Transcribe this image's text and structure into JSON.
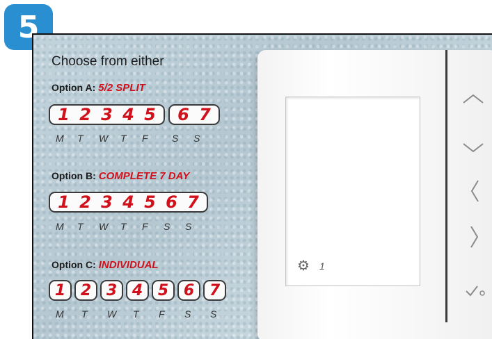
{
  "step_number": "5",
  "intro": "Choose from either",
  "options": [
    {
      "label": "Option A:",
      "name": "5/2 SPLIT",
      "groups": [
        [
          "1",
          "2",
          "3",
          "4",
          "5"
        ],
        [
          "6",
          "7"
        ]
      ]
    },
    {
      "label": "Option B:",
      "name": "COMPLETE 7 DAY",
      "groups": [
        [
          "1",
          "2",
          "3",
          "4",
          "5",
          "6",
          "7"
        ]
      ]
    },
    {
      "label": "Option C:",
      "name": "INDIVIDUAL",
      "groups": [
        [
          "1"
        ],
        [
          "2"
        ],
        [
          "3"
        ],
        [
          "4"
        ],
        [
          "5"
        ],
        [
          "6"
        ],
        [
          "7"
        ]
      ]
    }
  ],
  "days": [
    "M",
    "T",
    "W",
    "T",
    "F",
    "S",
    "S"
  ],
  "thermostat": {
    "screen_number": "1",
    "icons": {
      "settings": "gear-icon",
      "up": "chevron-up-icon",
      "down": "chevron-down-icon",
      "left": "chevron-left-icon",
      "right": "chevron-right-icon",
      "confirm": "checkmark-icon"
    }
  },
  "colors": {
    "accent_red": "#d0101a",
    "badge_blue": "#2a8fd0"
  }
}
